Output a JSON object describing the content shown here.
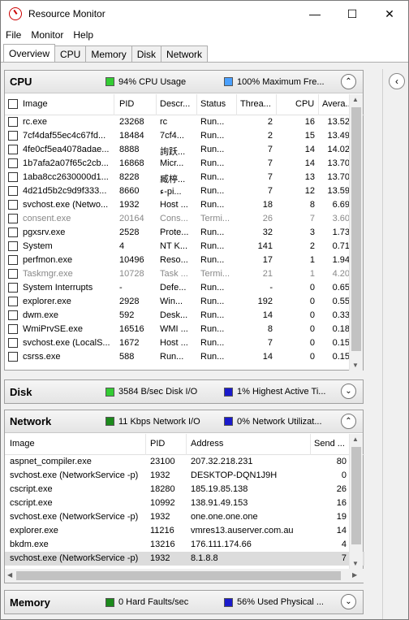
{
  "window": {
    "title": "Resource Monitor",
    "minimize": "—",
    "maximize": "☐",
    "close": "✕"
  },
  "menu": [
    "File",
    "Monitor",
    "Help"
  ],
  "tabs": [
    "Overview",
    "CPU",
    "Memory",
    "Disk",
    "Network"
  ],
  "colors": {
    "green": "#33cc33",
    "blue": "#4aa0ff",
    "darkblue": "#1a1acc",
    "darkgreen": "#1b8a1b"
  },
  "cpu": {
    "title": "CPU",
    "ind1": "94% CPU Usage",
    "ind2": "100% Maximum Fre...",
    "columns": [
      "Image",
      "PID",
      "Descr...",
      "Status",
      "Threa...",
      "CPU",
      "Avera..."
    ],
    "rows": [
      {
        "image": "rc.exe",
        "pid": "23268",
        "desc": "rc",
        "status": "Run...",
        "threads": "2",
        "cpu": "16",
        "avg": "13.52",
        "dim": false
      },
      {
        "image": "7cf4daf55ec4c67fd...",
        "pid": "18484",
        "desc": "7cf4...",
        "status": "Run...",
        "threads": "2",
        "cpu": "15",
        "avg": "13.49",
        "dim": false
      },
      {
        "image": "4fe0cf5ea4078adae...",
        "pid": "8888",
        "desc": "詢跃...",
        "status": "Run...",
        "threads": "7",
        "cpu": "14",
        "avg": "14.02",
        "dim": false
      },
      {
        "image": "1b7afa2a07f65c2cb...",
        "pid": "16868",
        "desc": "Micr...",
        "status": "Run...",
        "threads": "7",
        "cpu": "14",
        "avg": "13.70",
        "dim": false
      },
      {
        "image": "1aba8cc2630000d1...",
        "pid": "8228",
        "desc": "臧楟...",
        "status": "Run...",
        "threads": "7",
        "cpu": "13",
        "avg": "13.70",
        "dim": false
      },
      {
        "image": "4d21d5b2c9d9f333...",
        "pid": "8660",
        "desc": "ء-pi...",
        "status": "Run...",
        "threads": "7",
        "cpu": "12",
        "avg": "13.59",
        "dim": false
      },
      {
        "image": "svchost.exe (Netwo...",
        "pid": "1932",
        "desc": "Host ...",
        "status": "Run...",
        "threads": "18",
        "cpu": "8",
        "avg": "6.69",
        "dim": false
      },
      {
        "image": "consent.exe",
        "pid": "20164",
        "desc": "Cons...",
        "status": "Termi...",
        "threads": "26",
        "cpu": "7",
        "avg": "3.60",
        "dim": true
      },
      {
        "image": "pgxsrv.exe",
        "pid": "2528",
        "desc": "Prote...",
        "status": "Run...",
        "threads": "32",
        "cpu": "3",
        "avg": "1.73",
        "dim": false
      },
      {
        "image": "System",
        "pid": "4",
        "desc": "NT K...",
        "status": "Run...",
        "threads": "141",
        "cpu": "2",
        "avg": "0.71",
        "dim": false
      },
      {
        "image": "perfmon.exe",
        "pid": "10496",
        "desc": "Reso...",
        "status": "Run...",
        "threads": "17",
        "cpu": "1",
        "avg": "1.94",
        "dim": false
      },
      {
        "image": "Taskmgr.exe",
        "pid": "10728",
        "desc": "Task ...",
        "status": "Termi...",
        "threads": "21",
        "cpu": "1",
        "avg": "4.20",
        "dim": true
      },
      {
        "image": "System Interrupts",
        "pid": "-",
        "desc": "Defe...",
        "status": "Run...",
        "threads": "-",
        "cpu": "0",
        "avg": "0.65",
        "dim": false
      },
      {
        "image": "explorer.exe",
        "pid": "2928",
        "desc": "Win...",
        "status": "Run...",
        "threads": "192",
        "cpu": "0",
        "avg": "0.55",
        "dim": false
      },
      {
        "image": "dwm.exe",
        "pid": "592",
        "desc": "Desk...",
        "status": "Run...",
        "threads": "14",
        "cpu": "0",
        "avg": "0.33",
        "dim": false
      },
      {
        "image": "WmiPrvSE.exe",
        "pid": "16516",
        "desc": "WMI ...",
        "status": "Run...",
        "threads": "8",
        "cpu": "0",
        "avg": "0.18",
        "dim": false
      },
      {
        "image": "svchost.exe (LocalS...",
        "pid": "1672",
        "desc": "Host ...",
        "status": "Run...",
        "threads": "7",
        "cpu": "0",
        "avg": "0.15",
        "dim": false
      },
      {
        "image": "csrss.exe",
        "pid": "588",
        "desc": "Run...",
        "status": "Run...",
        "threads": "14",
        "cpu": "0",
        "avg": "0.15",
        "dim": false
      }
    ]
  },
  "disk": {
    "title": "Disk",
    "ind1": "3584 B/sec Disk I/O",
    "ind2": "1% Highest Active Ti..."
  },
  "network": {
    "title": "Network",
    "ind1": "11 Kbps Network I/O",
    "ind2": "0% Network Utilizat...",
    "columns": [
      "Image",
      "PID",
      "Address",
      "Send ..."
    ],
    "rows": [
      {
        "image": "aspnet_compiler.exe",
        "pid": "23100",
        "address": "207.32.218.231",
        "send": "80"
      },
      {
        "image": "svchost.exe (NetworkService -p)",
        "pid": "1932",
        "address": "DESKTOP-DQN1J9H",
        "send": "0"
      },
      {
        "image": "cscript.exe",
        "pid": "18280",
        "address": "185.19.85.138",
        "send": "26"
      },
      {
        "image": "cscript.exe",
        "pid": "10992",
        "address": "138.91.49.153",
        "send": "16"
      },
      {
        "image": "svchost.exe (NetworkService -p)",
        "pid": "1932",
        "address": "one.one.one.one",
        "send": "19"
      },
      {
        "image": "explorer.exe",
        "pid": "11216",
        "address": "vmres13.auserver.com.au",
        "send": "14"
      },
      {
        "image": "bkdm.exe",
        "pid": "13216",
        "address": "176.111.174.66",
        "send": "4"
      },
      {
        "image": "svchost.exe (NetworkService -p)",
        "pid": "1932",
        "address": "8.1.8.8",
        "send": "7"
      }
    ]
  },
  "memory": {
    "title": "Memory",
    "ind1": "0 Hard Faults/sec",
    "ind2": "56% Used Physical ..."
  }
}
